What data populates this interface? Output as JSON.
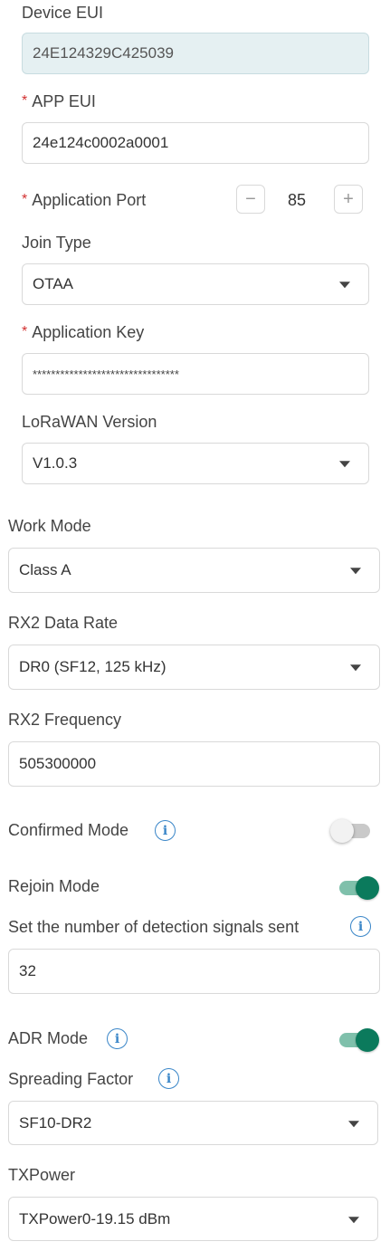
{
  "device_eui": {
    "label": "Device EUI",
    "value": "24E124329C425039"
  },
  "app_eui": {
    "required_mark": "*",
    "label": "APP EUI",
    "value": "24e124c0002a0001"
  },
  "application_port": {
    "required_mark": "*",
    "label": "Application Port",
    "value": "85",
    "decrement": "−",
    "increment": "+"
  },
  "join_type": {
    "label": "Join Type",
    "value": "OTAA"
  },
  "application_key": {
    "required_mark": "*",
    "label": "Application Key",
    "value": "********************************"
  },
  "lorawan_version": {
    "label": "LoRaWAN Version",
    "value": "V1.0.3"
  },
  "work_mode": {
    "label": "Work Mode",
    "value": "Class A"
  },
  "rx2_data_rate": {
    "label": "RX2 Data Rate",
    "value": "DR0 (SF12, 125 kHz)"
  },
  "rx2_frequency": {
    "label": "RX2 Frequency",
    "value": "505300000"
  },
  "confirmed_mode": {
    "label": "Confirmed Mode",
    "enabled": false
  },
  "rejoin_mode": {
    "label": "Rejoin Mode",
    "enabled": true
  },
  "detection_signals": {
    "label": "Set the number of detection signals  sent",
    "value": "32"
  },
  "adr_mode": {
    "label": "ADR Mode",
    "enabled": true
  },
  "spreading_factor": {
    "label": "Spreading Factor",
    "value": "SF10-DR2"
  },
  "tx_power": {
    "label": "TXPower",
    "value": "TXPower0-19.15 dBm"
  },
  "icons": {
    "info": "i"
  },
  "colors": {
    "accent": "#0b7a5c",
    "toggle_track_on": "#7fc0ab",
    "info": "#3a86c8",
    "required": "#d23030",
    "disabled_bg": "#e5f0f2"
  }
}
